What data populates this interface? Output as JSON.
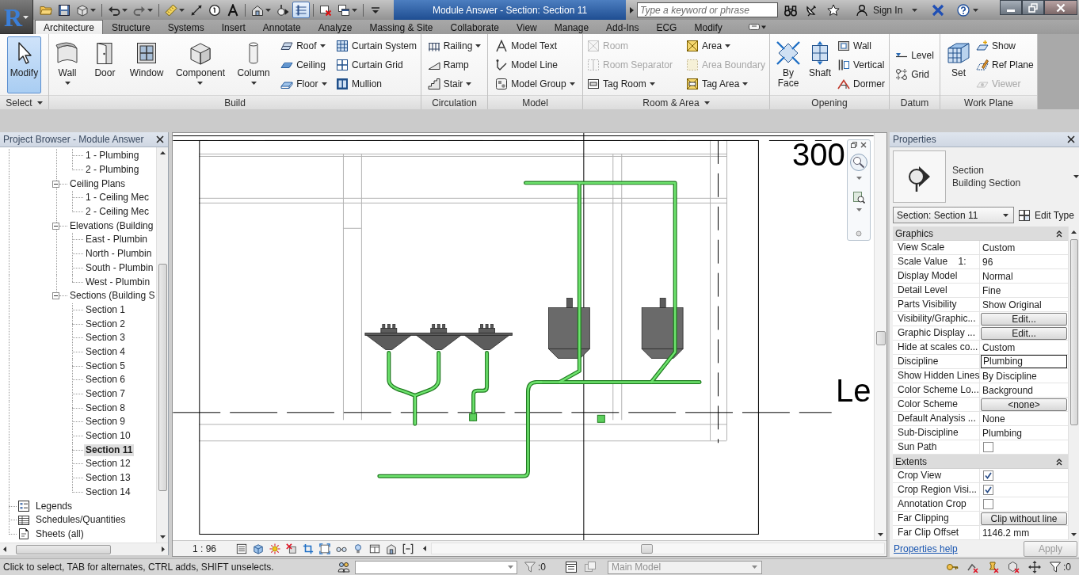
{
  "title_bar": {
    "app_letter": "R",
    "quick_access": [
      {
        "dropdown": false,
        "on": false
      },
      {
        "dropdown": false,
        "on": false
      },
      {
        "dropdown": true,
        "on": false
      },
      {
        "dropdown": true,
        "on": false
      },
      {
        "dropdown": true,
        "on": false
      },
      {
        "dropdown": true,
        "on": false
      },
      {
        "dropdown": false,
        "on": false
      },
      {
        "dropdown": false,
        "on": false
      },
      {
        "dropdown": false,
        "on": false
      },
      {
        "dropdown": true,
        "on": false
      },
      {
        "dropdown": false,
        "on": false
      },
      {
        "dropdown": false,
        "on": true
      },
      {
        "dropdown": false,
        "on": false
      },
      {
        "dropdown": true,
        "on": false
      },
      {
        "dropdown": false,
        "on": false
      }
    ],
    "title": "Module Answer - Section: Section 11",
    "search": {
      "placeholder": "Type a keyword or phrase"
    },
    "sign_in": "Sign In"
  },
  "ribbon": {
    "tabs": [
      {
        "label": "Architecture",
        "selected": true
      },
      {
        "label": "Structure",
        "selected": false
      },
      {
        "label": "Systems",
        "selected": false
      },
      {
        "label": "Insert",
        "selected": false
      },
      {
        "label": "Annotate",
        "selected": false
      },
      {
        "label": "Analyze",
        "selected": false
      },
      {
        "label": "Massing & Site",
        "selected": false
      },
      {
        "label": "Collaborate",
        "selected": false
      },
      {
        "label": "View",
        "selected": false
      },
      {
        "label": "Manage",
        "selected": false
      },
      {
        "label": "Add-Ins",
        "selected": false
      },
      {
        "label": "ECG",
        "selected": false
      },
      {
        "label": "Modify",
        "selected": false
      }
    ],
    "panels": [
      {
        "label": "Select",
        "dropdown": true,
        "columns": [
          [
            {
              "label": "Modify",
              "kind": "large",
              "dropdown": false,
              "disabled": false,
              "active": true
            }
          ]
        ]
      },
      {
        "label": "Build",
        "dropdown": false,
        "columns": [
          [
            {
              "label": "Wall",
              "kind": "large",
              "dropdown": true,
              "disabled": false,
              "active": false
            }
          ],
          [
            {
              "label": "Door",
              "kind": "large",
              "dropdown": false,
              "disabled": false,
              "active": false
            }
          ],
          [
            {
              "label": "Window",
              "kind": "large",
              "dropdown": false,
              "disabled": false,
              "active": false
            }
          ],
          [
            {
              "label": "Component",
              "kind": "large",
              "dropdown": true,
              "disabled": false,
              "active": false
            }
          ],
          [
            {
              "label": "Column",
              "kind": "large",
              "dropdown": true,
              "disabled": false,
              "active": false
            }
          ],
          [
            {
              "label": "Roof",
              "kind": "small",
              "dropdown": true,
              "disabled": false,
              "active": false
            },
            {
              "label": "Ceiling",
              "kind": "small",
              "dropdown": false,
              "disabled": false,
              "active": false
            },
            {
              "label": "Floor",
              "kind": "small",
              "dropdown": true,
              "disabled": false,
              "active": false
            }
          ],
          [
            {
              "label": "Curtain System",
              "kind": "small",
              "dropdown": false,
              "disabled": false,
              "active": false
            },
            {
              "label": "Curtain Grid",
              "kind": "small",
              "dropdown": false,
              "disabled": false,
              "active": false
            },
            {
              "label": "Mullion",
              "kind": "small",
              "dropdown": false,
              "disabled": false,
              "active": false
            }
          ]
        ]
      },
      {
        "label": "Circulation",
        "dropdown": false,
        "columns": [
          [
            {
              "label": "Railing",
              "kind": "small",
              "dropdown": true,
              "disabled": false,
              "active": false
            },
            {
              "label": "Ramp",
              "kind": "small",
              "dropdown": false,
              "disabled": false,
              "active": false
            },
            {
              "label": "Stair",
              "kind": "small",
              "dropdown": true,
              "disabled": false,
              "active": false
            }
          ]
        ]
      },
      {
        "label": "Model",
        "dropdown": false,
        "columns": [
          [
            {
              "label": "Model Text",
              "kind": "small",
              "dropdown": false,
              "disabled": false,
              "active": false
            },
            {
              "label": "Model Line",
              "kind": "small",
              "dropdown": false,
              "disabled": false,
              "active": false
            },
            {
              "label": "Model Group",
              "kind": "small",
              "dropdown": true,
              "disabled": false,
              "active": false
            }
          ]
        ]
      },
      {
        "label": "Room & Area",
        "dropdown": true,
        "columns": [
          [
            {
              "label": "Room",
              "kind": "small",
              "dropdown": false,
              "disabled": true,
              "active": false
            },
            {
              "label": "Room Separator",
              "kind": "small",
              "dropdown": false,
              "disabled": true,
              "active": false
            },
            {
              "label": "Tag Room",
              "kind": "small",
              "dropdown": true,
              "disabled": false,
              "active": false
            }
          ],
          [
            {
              "label": "Area",
              "kind": "small",
              "dropdown": true,
              "disabled": false,
              "active": false
            },
            {
              "label": "Area Boundary",
              "kind": "small",
              "dropdown": false,
              "disabled": true,
              "active": false
            },
            {
              "label": "Tag Area",
              "kind": "small",
              "dropdown": true,
              "disabled": false,
              "active": false
            }
          ]
        ]
      },
      {
        "label": "Opening",
        "dropdown": false,
        "columns": [
          [
            {
              "label": "By Face",
              "kind": "large",
              "dropdown": false,
              "disabled": false,
              "active": false
            }
          ],
          [
            {
              "label": "Shaft",
              "kind": "large",
              "dropdown": false,
              "disabled": false,
              "active": false
            }
          ],
          [
            {
              "label": "Wall",
              "kind": "small",
              "dropdown": false,
              "disabled": false,
              "active": false
            },
            {
              "label": "Vertical",
              "kind": "small",
              "dropdown": false,
              "disabled": false,
              "active": false
            },
            {
              "label": "Dormer",
              "kind": "small",
              "dropdown": false,
              "disabled": false,
              "active": false
            }
          ]
        ]
      },
      {
        "label": "Datum",
        "dropdown": false,
        "columns": [
          [
            {
              "label": "Level",
              "kind": "small",
              "dropdown": false,
              "disabled": false,
              "active": false
            },
            {
              "label": "Grid",
              "kind": "small",
              "dropdown": false,
              "disabled": false,
              "active": false
            }
          ]
        ]
      },
      {
        "label": "Work Plane",
        "dropdown": false,
        "columns": [
          [
            {
              "label": "Set",
              "kind": "large",
              "dropdown": false,
              "disabled": false,
              "active": false
            }
          ],
          [
            {
              "label": "Show",
              "kind": "small",
              "dropdown": false,
              "disabled": false,
              "active": false
            },
            {
              "label": "Ref Plane",
              "kind": "small",
              "dropdown": false,
              "disabled": false,
              "active": false
            },
            {
              "label": "Viewer",
              "kind": "small",
              "dropdown": false,
              "disabled": true,
              "active": false
            }
          ]
        ]
      }
    ]
  },
  "project_browser": {
    "title": "Project Browser - Module Answer",
    "tree": [
      {
        "children": [
          {
            "children": [
              {
                "label": "1 - Plumbing",
                "selected": false
              },
              {
                "label": "2 - Plumbing",
                "selected": false
              }
            ]
          },
          {
            "label": "Ceiling Plans",
            "expanded": true,
            "selected": false,
            "children": [
              {
                "label": "1 - Ceiling Mec",
                "selected": false
              },
              {
                "label": "2 - Ceiling Mec",
                "selected": false
              }
            ]
          },
          {
            "label": "Elevations (Building",
            "expanded": true,
            "selected": false,
            "children": [
              {
                "label": "East - Plumbin",
                "selected": false
              },
              {
                "label": "North - Plumbin",
                "selected": false
              },
              {
                "label": "South - Plumbin",
                "selected": false
              },
              {
                "label": "West - Plumbin",
                "selected": false
              }
            ]
          },
          {
            "label": "Sections (Building S",
            "expanded": true,
            "selected": false,
            "children": [
              {
                "label": "Section 1",
                "selected": false
              },
              {
                "label": "Section 2",
                "selected": false
              },
              {
                "label": "Section 3",
                "selected": false
              },
              {
                "label": "Section 4",
                "selected": false
              },
              {
                "label": "Section 5",
                "selected": false
              },
              {
                "label": "Section 6",
                "selected": false
              },
              {
                "label": "Section 7",
                "selected": false
              },
              {
                "label": "Section 8",
                "selected": false
              },
              {
                "label": "Section 9",
                "selected": false
              },
              {
                "label": "Section 10",
                "selected": false
              },
              {
                "label": "Section 11",
                "selected": true
              },
              {
                "label": "Section 12",
                "selected": false
              },
              {
                "label": "Section 13",
                "selected": false
              },
              {
                "label": "Section 14",
                "selected": false
              }
            ]
          }
        ]
      },
      {
        "label": "Legends",
        "kind": "legends",
        "selected": false
      },
      {
        "label": "Schedules/Quantities",
        "kind": "schedules",
        "selected": false
      },
      {
        "label": "Sheets (all)",
        "kind": "sheets",
        "selected": false
      }
    ]
  },
  "view": {
    "annotations": [
      "300",
      "Le"
    ],
    "scale": "1 : 96"
  },
  "properties": {
    "title": "Properties",
    "type_family": "Section",
    "type_name": "Building Section",
    "instance": "Section: Section 11",
    "edit_type": "Edit Type",
    "groups": [
      {
        "label": "Graphics",
        "expanded": true,
        "rows": [
          {
            "label": "View Scale",
            "kind": "text",
            "value": "Custom"
          },
          {
            "label": "Scale Value    1:",
            "kind": "text",
            "value": "96"
          },
          {
            "label": "Display Model",
            "kind": "text",
            "value": "Normal"
          },
          {
            "label": "Detail Level",
            "kind": "text",
            "value": "Fine"
          },
          {
            "label": "Parts Visibility",
            "kind": "text",
            "value": "Show Original"
          },
          {
            "label": "Visibility/Graphic...",
            "kind": "button",
            "value": "Edit..."
          },
          {
            "label": "Graphic Display ...",
            "kind": "button",
            "value": "Edit..."
          },
          {
            "label": "Hide at scales co...",
            "kind": "text",
            "value": "Custom"
          },
          {
            "label": "Discipline",
            "kind": "field",
            "value": "Plumbing"
          },
          {
            "label": "Show Hidden Lines",
            "kind": "text",
            "value": "By Discipline"
          },
          {
            "label": "Color Scheme Lo...",
            "kind": "text",
            "value": "Background"
          },
          {
            "label": "Color Scheme",
            "kind": "button",
            "value": "<none>"
          },
          {
            "label": "Default Analysis ...",
            "kind": "text",
            "value": "None"
          },
          {
            "label": "Sub-Discipline",
            "kind": "text",
            "value": "Plumbing"
          },
          {
            "label": "Sun Path",
            "kind": "checkbox",
            "checked": false
          }
        ]
      },
      {
        "label": "Extents",
        "expanded": true,
        "rows": [
          {
            "label": "Crop View",
            "kind": "checkbox",
            "checked": true
          },
          {
            "label": "Crop Region Visi...",
            "kind": "checkbox",
            "checked": true
          },
          {
            "label": "Annotation Crop",
            "kind": "checkbox",
            "checked": false
          },
          {
            "label": "Far Clipping",
            "kind": "button",
            "value": "Clip without line"
          },
          {
            "label": "Far Clip Offset",
            "kind": "text",
            "value": "1146.2 mm"
          }
        ]
      }
    ],
    "help": "Properties help",
    "apply": {
      "label": "Apply",
      "disabled": true
    }
  },
  "status_bar": {
    "message": "Click to select, TAB for alternates, CTRL adds, SHIFT unselects.",
    "counts": [
      ":0",
      ":0"
    ],
    "model": {
      "value": "Main Model",
      "disabled": true
    }
  }
}
